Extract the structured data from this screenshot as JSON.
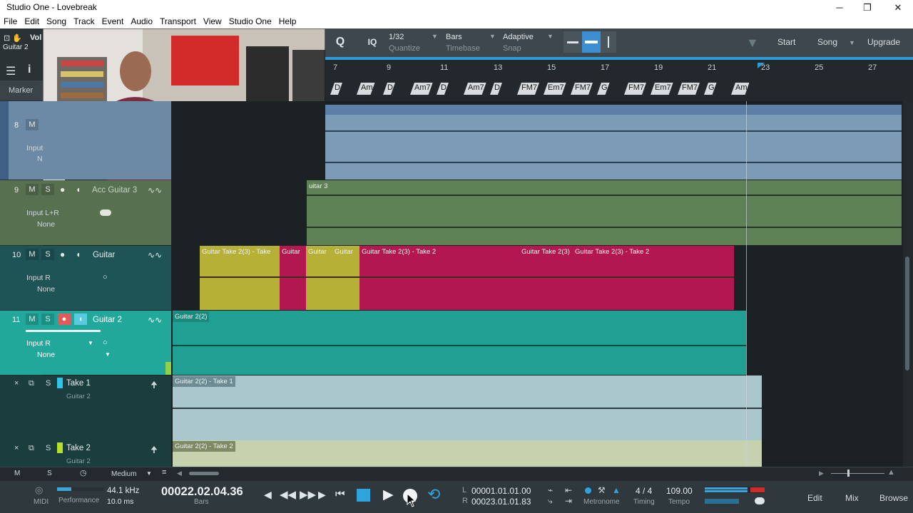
{
  "window": {
    "title": "Studio One - Lovebreak",
    "min": "─",
    "max": "❐",
    "close": "✕"
  },
  "menu": [
    "File",
    "Edit",
    "Song",
    "Track",
    "Event",
    "Audio",
    "Transport",
    "View",
    "Studio One",
    "Help"
  ],
  "left_panel": {
    "vol_label": "Vol",
    "track_label": "Guitar 2",
    "marker_label": "Marker"
  },
  "toolbar": {
    "quantize_value": "1/32",
    "quantize_label": "Quantize",
    "timebase_value": "Bars",
    "timebase_label": "Timebase",
    "snap_value": "Adaptive",
    "snap_label": "Snap",
    "iq": "IQ",
    "start": "Start",
    "song": "Song",
    "upgrade": "Upgrade"
  },
  "ruler": {
    "bars": [
      "7",
      "9",
      "11",
      "13",
      "15",
      "17",
      "19",
      "21",
      "23",
      "25",
      "27"
    ]
  },
  "chords": [
    "D",
    "Am",
    "D",
    "Am7",
    "D",
    "Am7",
    "D",
    "FM7",
    "Em7",
    "FM7",
    "G",
    "FM7",
    "Em7",
    "FM7",
    "G",
    "Am"
  ],
  "tracks": [
    {
      "number": "8",
      "mute": "M",
      "name": "",
      "input": "Input",
      "output": "N"
    },
    {
      "number": "9",
      "mute": "M",
      "solo": "S",
      "name": "Acc Guitar 3",
      "input": "Input L+R",
      "output": "None"
    },
    {
      "number": "10",
      "mute": "M",
      "solo": "S",
      "name": "Guitar",
      "input": "Input R",
      "output": "None"
    },
    {
      "number": "11",
      "mute": "M",
      "solo": "S",
      "name": "Guitar 2",
      "input": "Input R",
      "output": "None"
    }
  ],
  "takes": [
    {
      "name": "Take 1",
      "sub": "Guitar 2",
      "solo": "S",
      "color": "#2fc3e8"
    },
    {
      "name": "Take 2",
      "sub": "Guitar 2",
      "solo": "S",
      "color": "#b5e02a"
    }
  ],
  "clips": {
    "acc_guitar": "uitar 3",
    "guitar_a": "Guitar Take 2(3) - Take",
    "guitar_b": "Guitar",
    "guitar_c": "Guitar",
    "guitar_d": "Guitar",
    "guitar_e": "Guitar Take 2(3) - Take 2",
    "guitar_f": "Guitar Take 2(3)",
    "guitar_g": "Guitar Take 2(3) - Take 2",
    "guitar2": "Guitar 2(2)",
    "take1": "Guitar 2(2) - Take 1",
    "take2": "Guitar 2(2) - Take 2"
  },
  "lanebar": {
    "m": "M",
    "s": "S",
    "zoom": "Medium"
  },
  "transport": {
    "midi": "MIDI",
    "performance": "Performance",
    "sample_rate": "44.1 kHz",
    "latency": "10.0 ms",
    "position": "00022.02.04.36",
    "position_unit": "Bars",
    "loop_left_label": "L",
    "loop_left": "00001.01.01.00",
    "loop_right_label": "R",
    "loop_right": "00023.01.01.83",
    "metronome": "Metronome",
    "signature": "4 / 4",
    "timing": "Timing",
    "tempo_value": "109.00",
    "tempo_label": "Tempo",
    "edit": "Edit",
    "mix": "Mix",
    "browse": "Browse"
  }
}
